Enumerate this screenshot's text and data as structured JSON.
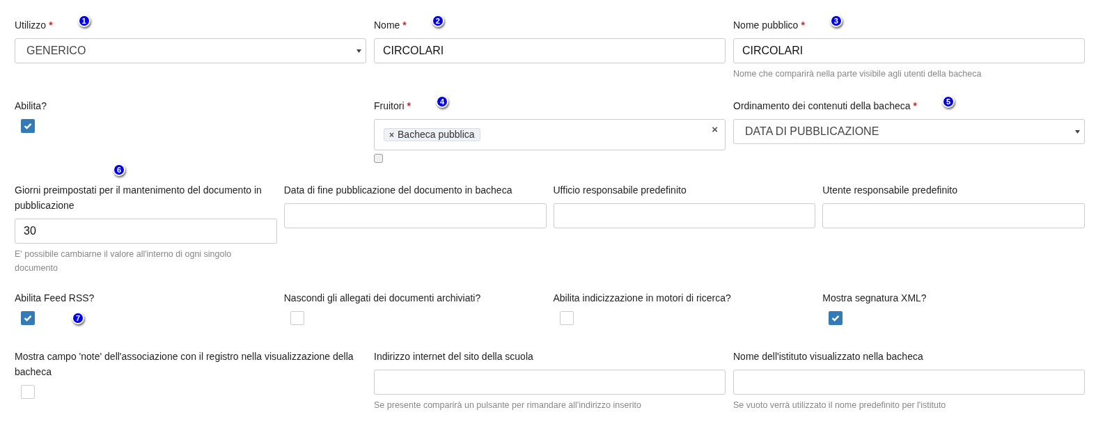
{
  "rows": [
    {
      "fields": [
        {
          "kind": "select",
          "label": "Utilizzo",
          "asterisk": "*",
          "badge": "1",
          "value": "GENERICO"
        },
        {
          "kind": "text",
          "label": "Nome",
          "asterisk": "*",
          "badge": "2",
          "value": "CIRCOLARI"
        },
        {
          "kind": "text",
          "label": "Nome pubblico",
          "asterisk": "*",
          "badge": "3",
          "value": "CIRCOLARI",
          "hint": "Nome che comparirà nella parte visibile agli utenti della bacheca"
        }
      ]
    },
    {
      "fields": [
        {
          "kind": "checkbox",
          "label": "Abilita?",
          "checked": true
        },
        {
          "kind": "tags",
          "label": "Fruitori",
          "asterisk": "*",
          "badge": "4",
          "tags": [
            "Bacheca pubblica"
          ],
          "clear": "×",
          "tag_remove": "×",
          "checked": false
        },
        {
          "kind": "select",
          "label": "Ordinamento dei contenuti della bacheca",
          "asterisk": "*",
          "badge": "5",
          "value": "DATA DI PUBBLICAZIONE"
        }
      ]
    },
    {
      "fields": [
        {
          "kind": "text",
          "label": "Giorni preimpostati per il mantenimento del documento in pubblicazione",
          "badge": "6",
          "badge_above": true,
          "value": "30",
          "hint": "E' possibile cambiarne il valore all'interno di ogni singolo documento"
        },
        {
          "kind": "text",
          "label": "Data di fine pubblicazione del documento in bacheca"
        },
        {
          "kind": "text",
          "label": "Ufficio responsabile predefinito"
        },
        {
          "kind": "text",
          "label": "Utente responsabile predefinito"
        }
      ]
    },
    {
      "fields": [
        {
          "kind": "checkbox",
          "label": "Abilita Feed RSS?",
          "checked": true,
          "badge": "7"
        },
        {
          "kind": "checkbox",
          "label": "Nascondi gli allegati dei documenti archiviati?",
          "checked": false
        },
        {
          "kind": "checkbox",
          "label": "Abilita indicizzazione in motori di ricerca?",
          "checked": false
        },
        {
          "kind": "checkbox",
          "label": "Mostra segnatura XML?",
          "checked": true
        }
      ]
    },
    {
      "fields": [
        {
          "kind": "checkbox",
          "label": "Mostra campo 'note' dell'associazione con il registro nella visualizzazione della bacheca",
          "checked": false
        },
        {
          "kind": "text",
          "label": "Indirizzo internet del sito della scuola",
          "hint": "Se presente comparirà un pulsante per rimandare all'indirizzo inserito"
        },
        {
          "kind": "text",
          "label": "Nome dell'istituto visualizzato nella bacheca",
          "hint": "Se vuoto verrà utilizzato il nome predefinito per l'istituto"
        }
      ]
    }
  ]
}
